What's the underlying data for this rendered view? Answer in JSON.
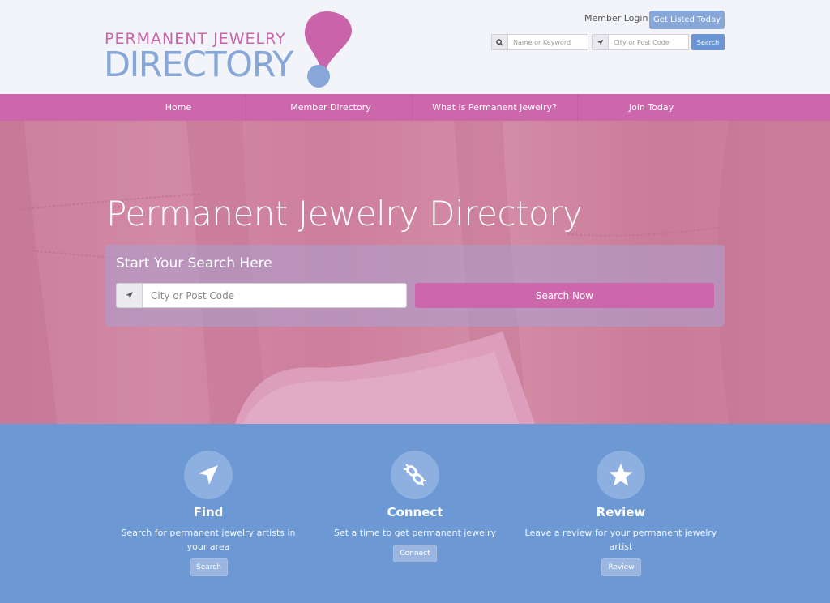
{
  "logo": {
    "line1": "PERMANENT JEWELRY",
    "line2": "DIRECTORY"
  },
  "header": {
    "member_login": "Member Login",
    "get_listed": "Get Listed Today",
    "keyword_placeholder": "Name or Keyword",
    "location_placeholder": "City or Post Code",
    "search_label": "Search"
  },
  "nav": {
    "items": [
      {
        "label": "Home"
      },
      {
        "label": "Member Directory"
      },
      {
        "label": "What is Permanent Jewelry?"
      },
      {
        "label": "Join Today"
      }
    ]
  },
  "hero": {
    "title": "Permanent Jewelry Directory",
    "panel_title": "Start Your Search Here",
    "location_placeholder": "City or Post Code",
    "search_button": "Search Now"
  },
  "features": [
    {
      "icon": "location-arrow-icon",
      "title": "Find",
      "desc": "Search for permanent jewelry artists in your area",
      "button": "Search"
    },
    {
      "icon": "broken-link-icon",
      "title": "Connect",
      "desc": "Set a time to get permanent jewelry",
      "button": "Connect"
    },
    {
      "icon": "star-icon",
      "title": "Review",
      "desc": "Leave a review for your permanent jewelry artist",
      "button": "Review"
    }
  ],
  "colors": {
    "pink": "#cd67ab",
    "blue": "#6c98d4",
    "light_blue": "#86a7d8",
    "background": "#f3f4f9"
  }
}
